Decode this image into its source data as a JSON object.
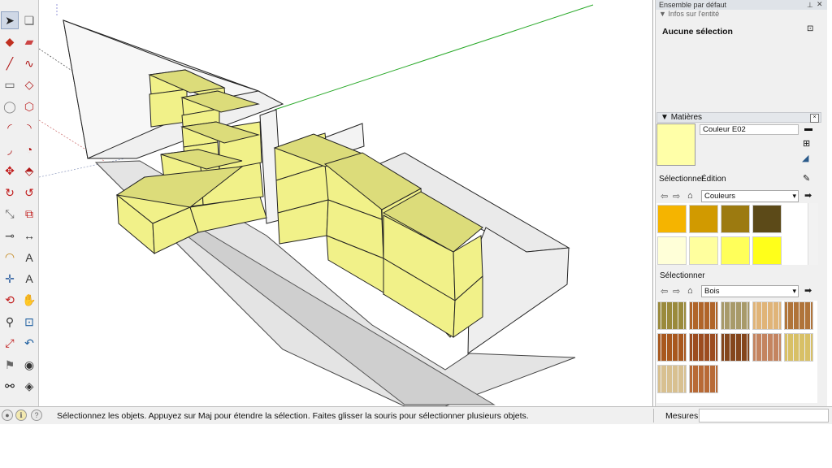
{
  "tools": [
    {
      "name": "select-icon"
    },
    {
      "name": "make-component-icon"
    },
    {
      "name": "paint-bucket-icon"
    },
    {
      "name": "eraser-icon"
    },
    {
      "name": "line-icon"
    },
    {
      "name": "freehand-icon"
    },
    {
      "name": "rectangle-icon"
    },
    {
      "name": "rotated-rectangle-icon"
    },
    {
      "name": "circle-icon"
    },
    {
      "name": "polygon-icon"
    },
    {
      "name": "arc-icon"
    },
    {
      "name": "two-point-arc-icon"
    },
    {
      "name": "three-point-arc-icon"
    },
    {
      "name": "pie-icon"
    },
    {
      "name": "move-icon"
    },
    {
      "name": "push-pull-icon"
    },
    {
      "name": "rotate-icon"
    },
    {
      "name": "follow-me-icon"
    },
    {
      "name": "scale-icon"
    },
    {
      "name": "offset-icon"
    },
    {
      "name": "tape-measure-icon"
    },
    {
      "name": "dimensions-icon"
    },
    {
      "name": "protractor-icon"
    },
    {
      "name": "text-icon"
    },
    {
      "name": "axes-icon"
    },
    {
      "name": "3d-text-icon"
    },
    {
      "name": "orbit-icon"
    },
    {
      "name": "pan-icon"
    },
    {
      "name": "zoom-icon"
    },
    {
      "name": "zoom-window-icon"
    },
    {
      "name": "zoom-extents-icon"
    },
    {
      "name": "previous-view-icon"
    },
    {
      "name": "position-camera-icon"
    },
    {
      "name": "look-around-icon"
    },
    {
      "name": "walk-icon"
    },
    {
      "name": "section-plane-icon"
    }
  ],
  "tray": {
    "title": "Ensemble par défaut",
    "entity_header": "Infos sur l'entité",
    "no_selection": "Aucune sélection",
    "materials_header": "Matières",
    "color_name": "Couleur E02",
    "tab_select": "Sélectionner",
    "tab_edit": "Édition",
    "colors_combo": "Couleurs",
    "select_header": "Sélectionner",
    "wood_combo": "Bois",
    "preview_color": "#ffffa8",
    "colors": [
      "#f5b400",
      "#d19a00",
      "#9c7a10",
      "#5c4a18",
      "#ffffd8",
      "#ffff9e",
      "#ffff5a",
      "#ffff1a",
      "#f6f200",
      "#cbcb00",
      "#8f8f12",
      "#5a5a10"
    ],
    "woods": [
      "#9a8a3c",
      "#b0652a",
      "#a89a6a",
      "#e0b478",
      "#b0743a",
      "#a8581e",
      "#9c4c20",
      "#84461c",
      "#c48460",
      "#d8c066",
      "#d8c090",
      "#b86a36"
    ]
  },
  "status": {
    "text": "Sélectionnez les objets. Appuyez sur Maj pour étendre la sélection. Faites glisser la souris pour sélectionner plusieurs objets.",
    "measures_label": "Mesures",
    "measures_value": ""
  }
}
